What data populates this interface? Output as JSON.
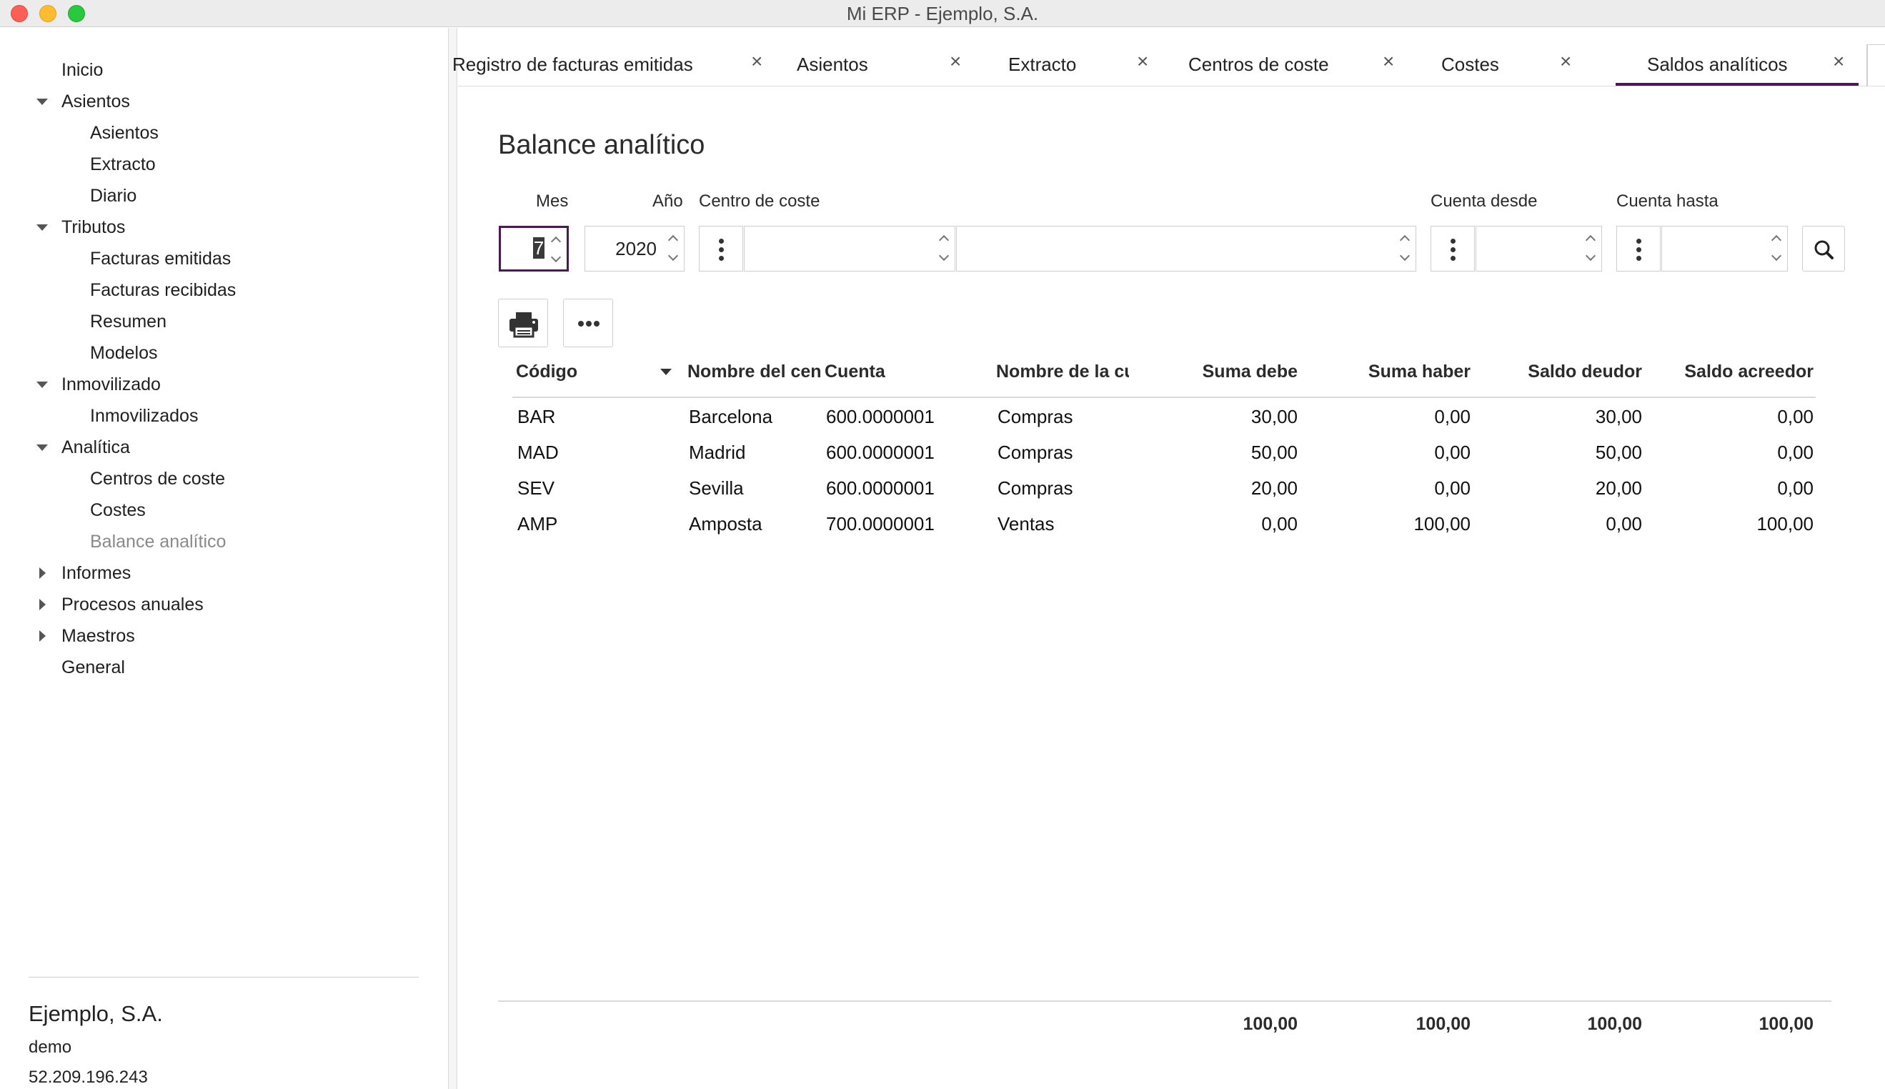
{
  "window": {
    "title": "Mi ERP - Ejemplo, S.A."
  },
  "sidebar": {
    "items": [
      {
        "label": "Inicio",
        "level": 0,
        "arrow": "none"
      },
      {
        "label": "Asientos",
        "level": 0,
        "arrow": "down"
      },
      {
        "label": "Asientos",
        "level": 1
      },
      {
        "label": "Extracto",
        "level": 1
      },
      {
        "label": "Diario",
        "level": 1
      },
      {
        "label": "Tributos",
        "level": 0,
        "arrow": "down"
      },
      {
        "label": "Facturas emitidas",
        "level": 1
      },
      {
        "label": "Facturas recibidas",
        "level": 1
      },
      {
        "label": "Resumen",
        "level": 1
      },
      {
        "label": "Modelos",
        "level": 1
      },
      {
        "label": "Inmovilizado",
        "level": 0,
        "arrow": "down"
      },
      {
        "label": "Inmovilizados",
        "level": 1
      },
      {
        "label": "Analítica",
        "level": 0,
        "arrow": "down"
      },
      {
        "label": "Centros de coste",
        "level": 1
      },
      {
        "label": "Costes",
        "level": 1
      },
      {
        "label": "Balance analítico",
        "level": 1,
        "selected": true
      },
      {
        "label": "Informes",
        "level": 0,
        "arrow": "right"
      },
      {
        "label": "Procesos anuales",
        "level": 0,
        "arrow": "right"
      },
      {
        "label": "Maestros",
        "level": 0,
        "arrow": "right"
      },
      {
        "label": "General",
        "level": 0,
        "arrow": "none"
      }
    ],
    "company": {
      "name": "Ejemplo, S.A.",
      "user": "demo",
      "ip": "52.209.196.243"
    }
  },
  "tabs": [
    {
      "label": "Registro de facturas emitidas",
      "active": false
    },
    {
      "label": "Asientos",
      "active": false
    },
    {
      "label": "Extracto",
      "active": false
    },
    {
      "label": "Centros de coste",
      "active": false
    },
    {
      "label": "Costes",
      "active": false
    },
    {
      "label": "Saldos analíticos",
      "active": true
    }
  ],
  "tab_close_glyph": "×",
  "page": {
    "title": "Balance analítico",
    "filters": {
      "mes_label": "Mes",
      "mes_value": "7",
      "anio_label": "Año",
      "anio_value": "2020",
      "centro_label": "Centro de coste",
      "centro_value": "",
      "centro_name_value": "",
      "cuenta_desde_label": "Cuenta desde",
      "cuenta_desde_value": "",
      "cuenta_hasta_label": "Cuenta hasta",
      "cuenta_hasta_value": ""
    }
  },
  "table": {
    "columns": [
      "Código",
      "Nombre del cen",
      "Cuenta",
      "Nombre de la cu",
      "Suma debe",
      "Suma haber",
      "Saldo deudor",
      "Saldo acreedor"
    ],
    "rows": [
      [
        "BAR",
        "Barcelona",
        "600.0000001",
        "Compras",
        "30,00",
        "0,00",
        "30,00",
        "0,00"
      ],
      [
        "MAD",
        "Madrid",
        "600.0000001",
        "Compras",
        "50,00",
        "0,00",
        "50,00",
        "0,00"
      ],
      [
        "SEV",
        "Sevilla",
        "600.0000001",
        "Compras",
        "20,00",
        "0,00",
        "20,00",
        "0,00"
      ],
      [
        "AMP",
        "Amposta",
        "700.0000001",
        "Ventas",
        "0,00",
        "100,00",
        "0,00",
        "100,00"
      ]
    ],
    "totals": [
      "100,00",
      "100,00",
      "100,00",
      "100,00"
    ]
  },
  "colors": {
    "accent": "#4a1952"
  }
}
